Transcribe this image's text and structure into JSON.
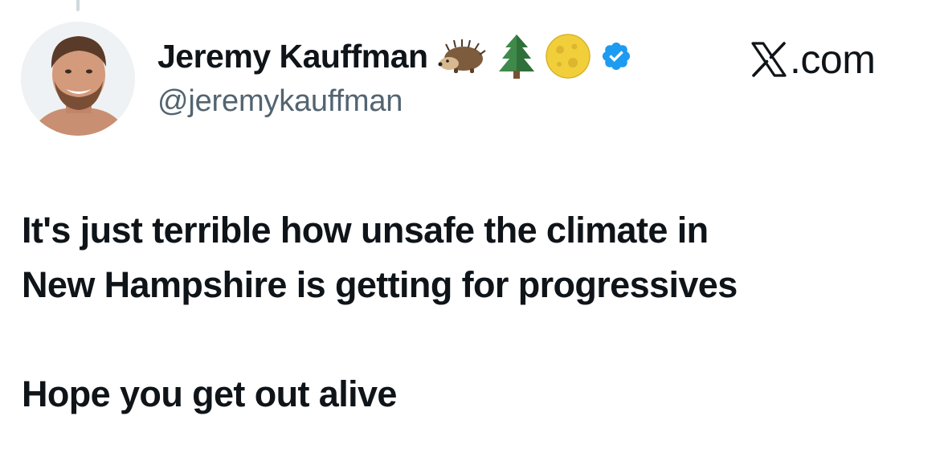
{
  "author": {
    "display_name": "Jeremy Kauffman",
    "handle": "@jeremykauffman",
    "badges": [
      "hedgehog-emoji",
      "evergreen-tree-emoji",
      "full-moon-emoji",
      "verified-badge-icon"
    ],
    "avatar": "avatar-photo"
  },
  "brand": {
    "icon": "x-logo-icon",
    "text": ".com"
  },
  "tweet": {
    "line1": "It's just terrible how unsafe the climate in",
    "line2": "New Hampshire is getting for progressives",
    "line3": "Hope you get out alive"
  },
  "colors": {
    "text": "#0f1419",
    "handle": "#536471",
    "verified": "#1d9bf0",
    "thread_line": "#cfd9de"
  }
}
